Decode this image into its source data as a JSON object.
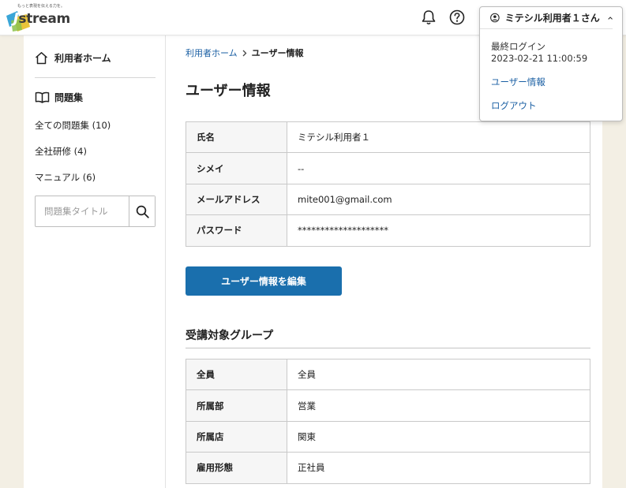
{
  "header": {
    "logo_tagline": "もっと表現を伝える力を。",
    "logo_j": "J",
    "logo_text": "stream",
    "bell_icon": "bell-icon",
    "help_icon": "question-circle-icon"
  },
  "user_menu": {
    "name": "ミテシル利用者１さん",
    "last_login_label": "最終ログイン",
    "last_login_time": "2023-02-21 11:00:59",
    "profile_link": "ユーザー情報",
    "logout_link": "ログアウト"
  },
  "sidebar": {
    "home_label": "利用者ホーム",
    "section_label": "問題集",
    "links": [
      {
        "label": "全ての問題集 (10)"
      },
      {
        "label": "全社研修 (4)"
      },
      {
        "label": "マニュアル (6)"
      }
    ],
    "search_placeholder": "問題集タイトル"
  },
  "breadcrumb": {
    "home": "利用者ホーム",
    "current": "ユーザー情報"
  },
  "page": {
    "title": "ユーザー情報",
    "user_fields": [
      {
        "label": "氏名",
        "value": "ミテシル利用者１"
      },
      {
        "label": "シメイ",
        "value": "--"
      },
      {
        "label": "メールアドレス",
        "value": "mite001@gmail.com"
      },
      {
        "label": "パスワード",
        "value": "********************"
      }
    ],
    "edit_button": "ユーザー情報を編集",
    "group_section_title": "受講対象グループ",
    "group_fields": [
      {
        "label": "全員",
        "value": "全員"
      },
      {
        "label": "所属部",
        "value": "営業"
      },
      {
        "label": "所属店",
        "value": "関東"
      },
      {
        "label": "雇用形態",
        "value": "正社員"
      }
    ]
  },
  "colors": {
    "background": "#f3efe4",
    "accent": "#1a6fad",
    "link": "#1a5fa3"
  }
}
